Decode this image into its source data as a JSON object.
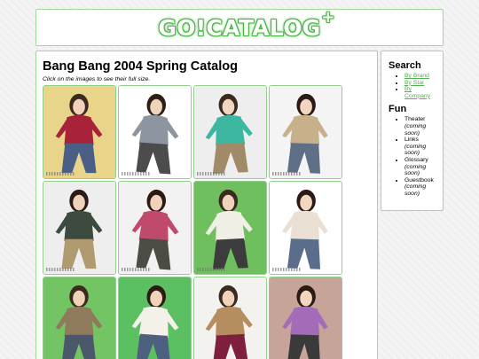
{
  "header": {
    "logo_text": "GO!CATALOG",
    "logo_plus": "+"
  },
  "main": {
    "title": "Bang Bang 2004 Spring Catalog",
    "instruction": "Click on the images to see their full size.",
    "photos": [
      {
        "bg": "#e8d58a",
        "clothes": "#a8233a",
        "pants": "#4a5f86",
        "skin": "#f1d3bb",
        "hair": "#3a2a20"
      },
      {
        "bg": "#ffffff",
        "clothes": "#8d95a0",
        "pants": "#4c4c4c",
        "skin": "#efd4bd",
        "hair": "#2e2018"
      },
      {
        "bg": "#eeeeee",
        "clothes": "#3db7a0",
        "pants": "#a18a67",
        "skin": "#f3d6bf",
        "hair": "#3a2a20"
      },
      {
        "bg": "#f4f4f4",
        "clothes": "#c7b08a",
        "pants": "#5e6f86",
        "skin": "#f3d6bf",
        "hair": "#2a1c14"
      },
      {
        "bg": "#eeeeee",
        "clothes": "#3d4a3f",
        "pants": "#b09a6f",
        "skin": "#efd2ba",
        "hair": "#2a1c14"
      },
      {
        "bg": "#f2f2f2",
        "clothes": "#c04a6c",
        "pants": "#4b4c44",
        "skin": "#f1d3bb",
        "hair": "#2a1c14"
      },
      {
        "bg": "#6fbf5e",
        "clothes": "#f0efe6",
        "pants": "#3c3c3c",
        "skin": "#f1d3bb",
        "hair": "#3a2a20"
      },
      {
        "bg": "#ffffff",
        "clothes": "#e9dfd2",
        "pants": "#5a6e8c",
        "skin": "#f3d6bf",
        "hair": "#2a1c14"
      },
      {
        "bg": "#73c463",
        "clothes": "#8f7b5c",
        "pants": "#4b586c",
        "skin": "#efd2ba",
        "hair": "#3a2a20"
      },
      {
        "bg": "#5cbf62",
        "clothes": "#f4f1e8",
        "pants": "#4e6080",
        "skin": "#f1d3bb",
        "hair": "#2a1c14"
      },
      {
        "bg": "#f4f2ef",
        "clothes": "#b58d5e",
        "pants": "#7d1f3d",
        "skin": "#f1d3bb",
        "hair": "#3a2a20"
      },
      {
        "bg": "#c6a49a",
        "clothes": "#a36bb8",
        "pants": "#3a3a3a",
        "skin": "#f3d6bf",
        "hair": "#2a1c14"
      }
    ]
  },
  "sidebar": {
    "search_heading": "Search",
    "search_links": [
      "By Brand",
      "By Star",
      "By Company"
    ],
    "fun_heading": "Fun",
    "fun_items": [
      {
        "label": "Theater",
        "note": "(coming soon)"
      },
      {
        "label": "Links",
        "note": "(coming soon)"
      },
      {
        "label": "Glossary",
        "note": "(coming soon)"
      },
      {
        "label": "Guestbook",
        "note": "(coming soon)"
      }
    ]
  }
}
